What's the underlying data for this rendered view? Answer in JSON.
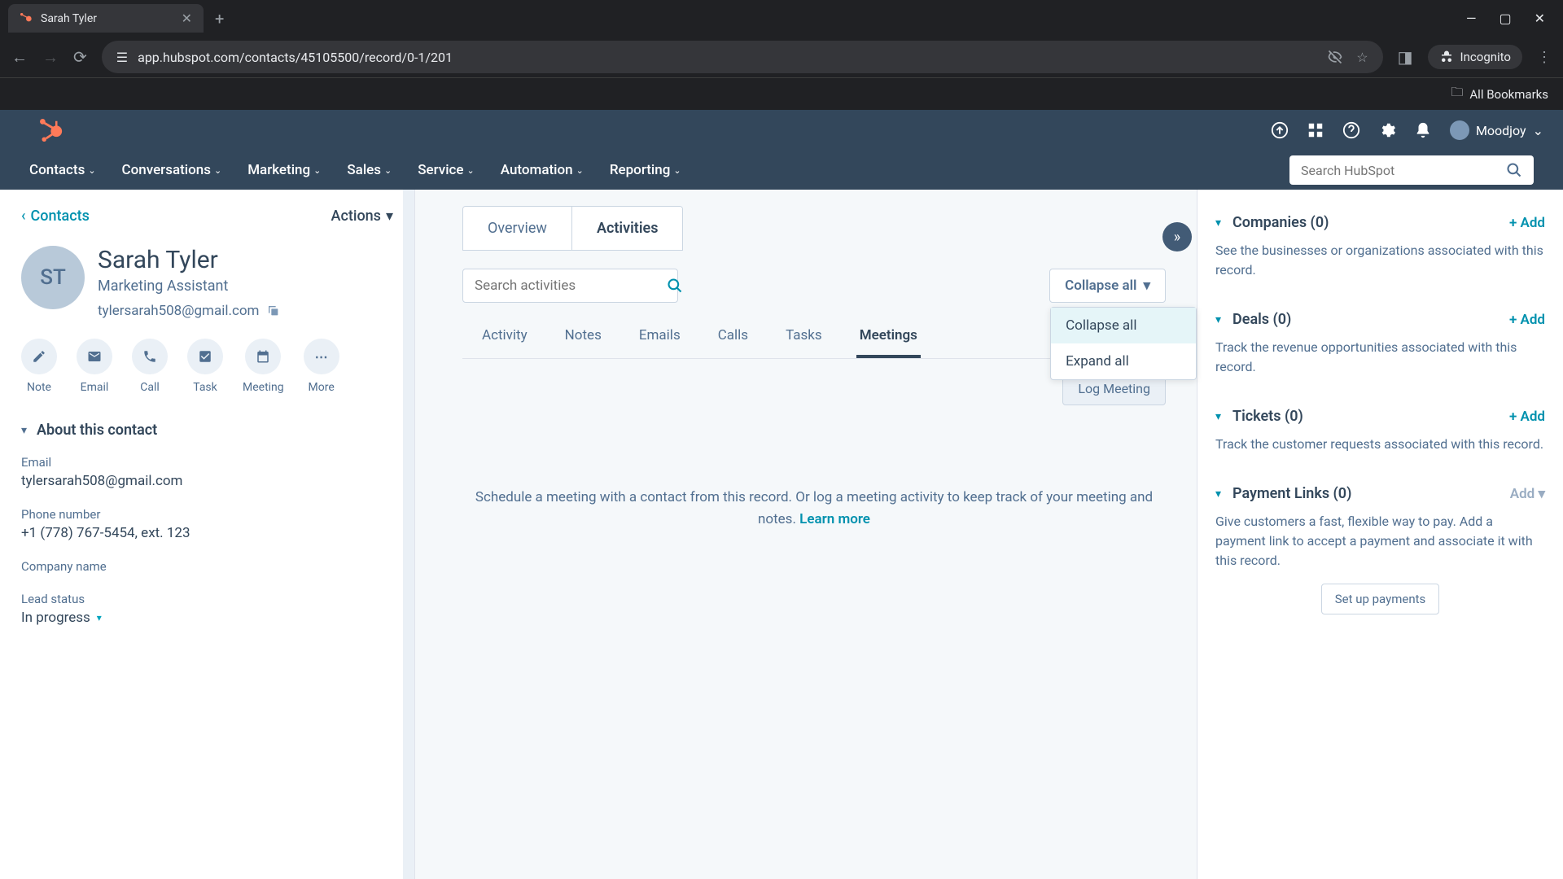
{
  "browser": {
    "tab_title": "Sarah Tyler",
    "url": "app.hubspot.com/contacts/45105500/record/0-1/201",
    "incognito": "Incognito",
    "all_bookmarks": "All Bookmarks"
  },
  "header": {
    "user_name": "Moodjoy",
    "search_placeholder": "Search HubSpot"
  },
  "nav": {
    "items": [
      "Contacts",
      "Conversations",
      "Marketing",
      "Sales",
      "Service",
      "Automation",
      "Reporting"
    ]
  },
  "left": {
    "back": "Contacts",
    "actions": "Actions",
    "initials": "ST",
    "name": "Sarah Tyler",
    "role": "Marketing Assistant",
    "email": "tylersarah508@gmail.com",
    "action_buttons": [
      "Note",
      "Email",
      "Call",
      "Task",
      "Meeting",
      "More"
    ],
    "about_section": "About this contact",
    "fields": {
      "email_label": "Email",
      "email_value": "tylersarah508@gmail.com",
      "phone_label": "Phone number",
      "phone_value": "+1 (778) 767-5454, ext. 123",
      "company_label": "Company name",
      "company_value": "",
      "lead_label": "Lead status",
      "lead_value": "In progress"
    }
  },
  "middle": {
    "tabs": {
      "overview": "Overview",
      "activities": "Activities"
    },
    "search_placeholder": "Search activities",
    "collapse_label": "Collapse all",
    "dropdown": {
      "collapse": "Collapse all",
      "expand": "Expand all"
    },
    "sub_tabs": [
      "Activity",
      "Notes",
      "Emails",
      "Calls",
      "Tasks",
      "Meetings"
    ],
    "log_meeting": "Log Meeting",
    "empty_text": "Schedule a meeting with a contact from this record. Or log a meeting activity to keep track of your meeting and notes. ",
    "learn_more": "Learn more"
  },
  "right": {
    "add": "+ Add",
    "add_plain": "Add",
    "companies": {
      "title": "Companies (0)",
      "desc": "See the businesses or organizations associated with this record."
    },
    "deals": {
      "title": "Deals (0)",
      "desc": "Track the revenue opportunities associated with this record."
    },
    "tickets": {
      "title": "Tickets (0)",
      "desc": "Track the customer requests associated with this record."
    },
    "payments": {
      "title": "Payment Links (0)",
      "desc": "Give customers a fast, flexible way to pay. Add a payment link to accept a payment and associate it with this record.",
      "setup": "Set up payments"
    }
  }
}
